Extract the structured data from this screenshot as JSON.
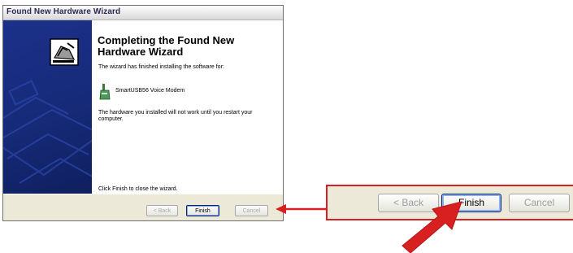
{
  "window": {
    "title": "Found New Hardware Wizard"
  },
  "content": {
    "heading": "Completing the Found New Hardware Wizard",
    "installed_text": "The wizard has finished installing the software for:",
    "device_name": "SmartUSB56 Voice Modem",
    "restart_text": "The hardware you installed will not work until you restart your computer.",
    "close_text": "Click Finish to close the wizard."
  },
  "buttons": {
    "back": "< Back",
    "finish": "Finish",
    "cancel": "Cancel"
  },
  "zoom": {
    "back": "< Back",
    "finish": "Finish",
    "cancel": "Cancel"
  },
  "icons": {
    "hardware": "hardware-wizard-icon",
    "device": "modem-icon",
    "pointer": "red-arrow-icon"
  },
  "colors": {
    "callout_red": "#d82020",
    "panel_blue": "#1b318a"
  }
}
